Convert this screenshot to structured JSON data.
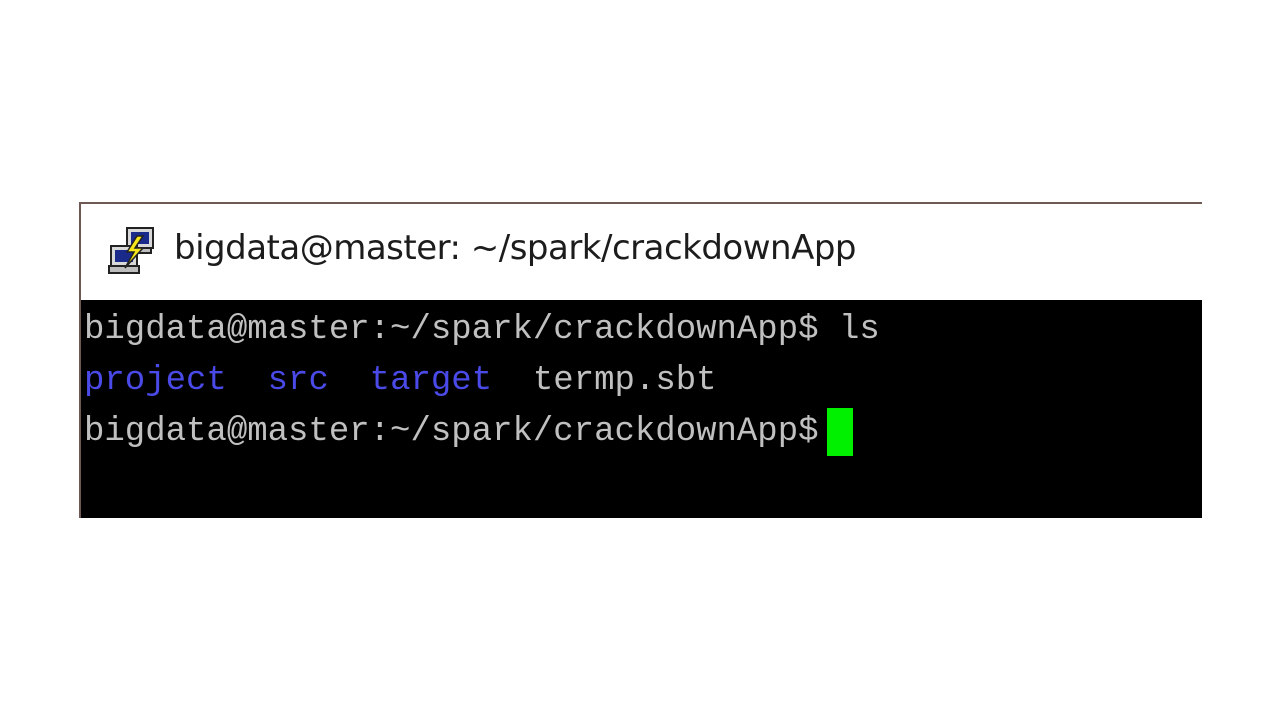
{
  "window": {
    "title": "bigdata@master: ~/spark/crackdownApp",
    "icon": "putty-icon"
  },
  "terminal": {
    "line1": {
      "prompt": "bigdata@master:~/spark/crackdownApp$",
      "command": "ls"
    },
    "listing": [
      {
        "name": "project",
        "type": "directory"
      },
      {
        "name": "src",
        "type": "directory"
      },
      {
        "name": "target",
        "type": "directory"
      },
      {
        "name": "termp.sbt",
        "type": "file"
      }
    ],
    "line3": {
      "prompt": "bigdata@master:~/spark/crackdownApp$"
    },
    "colors": {
      "background": "#000000",
      "foreground": "#c0c0c0",
      "directory": "#4a4ae8",
      "cursor": "#00f000"
    }
  }
}
